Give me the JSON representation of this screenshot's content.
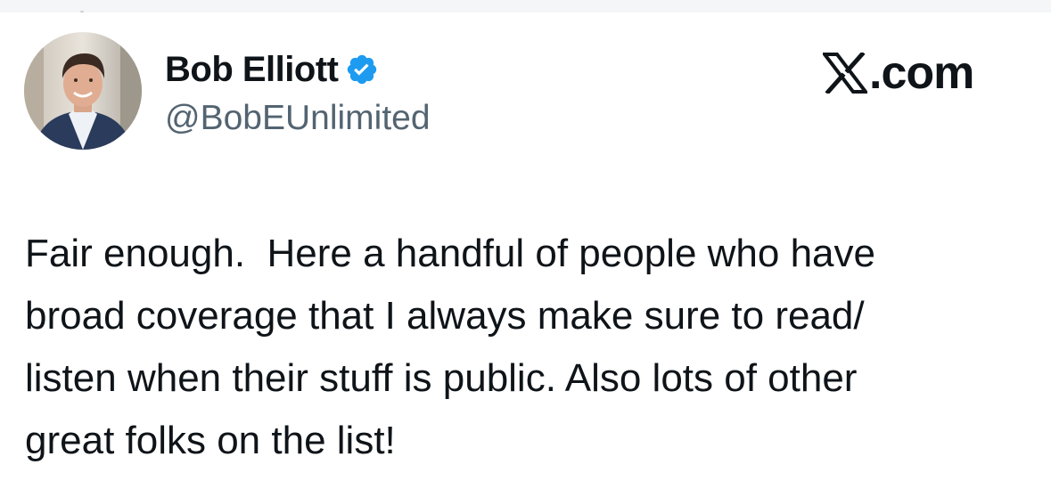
{
  "author": {
    "display_name": "Bob Elliott",
    "handle": "@BobEUnlimited",
    "verified": true,
    "avatar_icon": "profile-photo",
    "verified_icon": "verified-badge-icon"
  },
  "brand": {
    "icon": "x-logo-icon",
    "text": ".com"
  },
  "tweet": {
    "lines": [
      "Fair enough.  Here a handful of people who have",
      "broad coverage that I always make sure to read/",
      "listen when their stuff is public. Also lots of other",
      "great folks on the list!"
    ]
  },
  "colors": {
    "verified_blue": "#1d9bf0",
    "handle_gray": "#536471",
    "text": "#0f1419"
  }
}
